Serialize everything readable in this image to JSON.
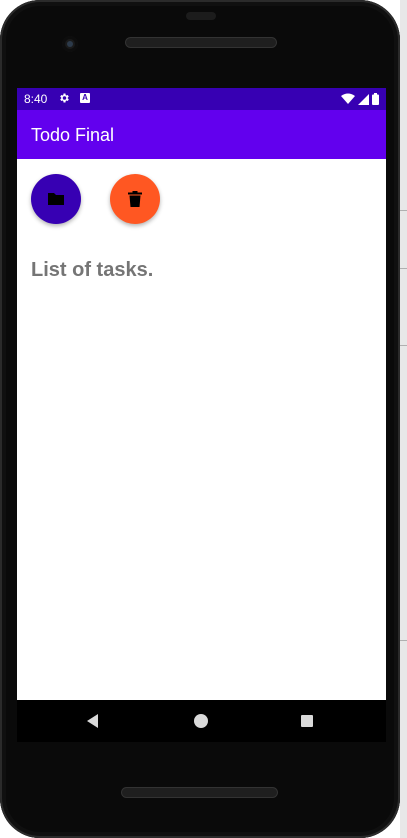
{
  "status_bar": {
    "time": "8:40",
    "icons": [
      "gear-icon",
      "font-icon",
      "wifi-icon",
      "signal-icon",
      "battery-icon"
    ],
    "color": "#3700b3"
  },
  "app_bar": {
    "title": "Todo Final",
    "color": "#6200ee"
  },
  "actions": {
    "save_icon": "folder-icon",
    "save_color": "#3700b3",
    "delete_icon": "trash-icon",
    "delete_color": "#ff5722"
  },
  "main": {
    "tasks_label": "List of tasks."
  },
  "nav_bar": {
    "buttons": [
      "back-icon",
      "home-icon",
      "recents-icon"
    ]
  }
}
